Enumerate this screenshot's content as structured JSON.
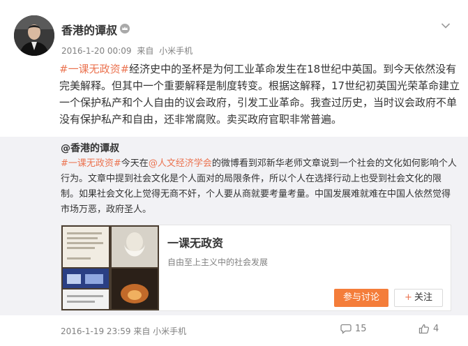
{
  "post": {
    "username": "香港的谭叔",
    "meta": {
      "time": "2016-1-20 00:09",
      "from": "来自",
      "device": "小米手机"
    },
    "body": {
      "topic": "#一课无政资#",
      "text": "经济史中的圣杯是为何工业革命发生在18世纪中英国。到今天依然没有完美解释。但其中一个重要解释是制度转变。根据这解释，17世纪初英国光荣革命建立一个保护私产和个人自由的议会政府，引发工业革命。我查过历史，当时议会政府不单没有保护私产和自由，还非常腐败。卖买政府官职非常普遍。"
    }
  },
  "repost": {
    "author": "@香港的谭叔",
    "topic": "#一课无政资#",
    "text_before_link": "今天在",
    "link": "@人文经济学会",
    "text_after_link": "的微博看到邓新华老师文章说到一个社会的文化如何影响个人行为。文章中提到社会文化是个人面对的局限条件，所以个人在选择行动上也受到社会文化的限制。如果社会文化上觉得无商不奸，个人要从商就要考量考量。中国发展难就难在中国人依然觉得市场万恶，政府圣人。",
    "card": {
      "title": "一课无政资",
      "desc": "自由至上主义中的社会发展",
      "join_label": "参与讨论",
      "follow_label": "关注"
    },
    "footer": {
      "time": "2016-1-19 23:59",
      "from": "来自",
      "device": "小米手机"
    },
    "reposts": "15",
    "likes": "4"
  },
  "icons": {
    "vip": "crown-icon",
    "menu": "chevron-down-icon",
    "repost": "comment-icon",
    "like": "thumbs-up-icon"
  },
  "colors": {
    "accent": "#eb7350",
    "button": "#f47d3a",
    "repost_bg": "#f2f2f5"
  }
}
